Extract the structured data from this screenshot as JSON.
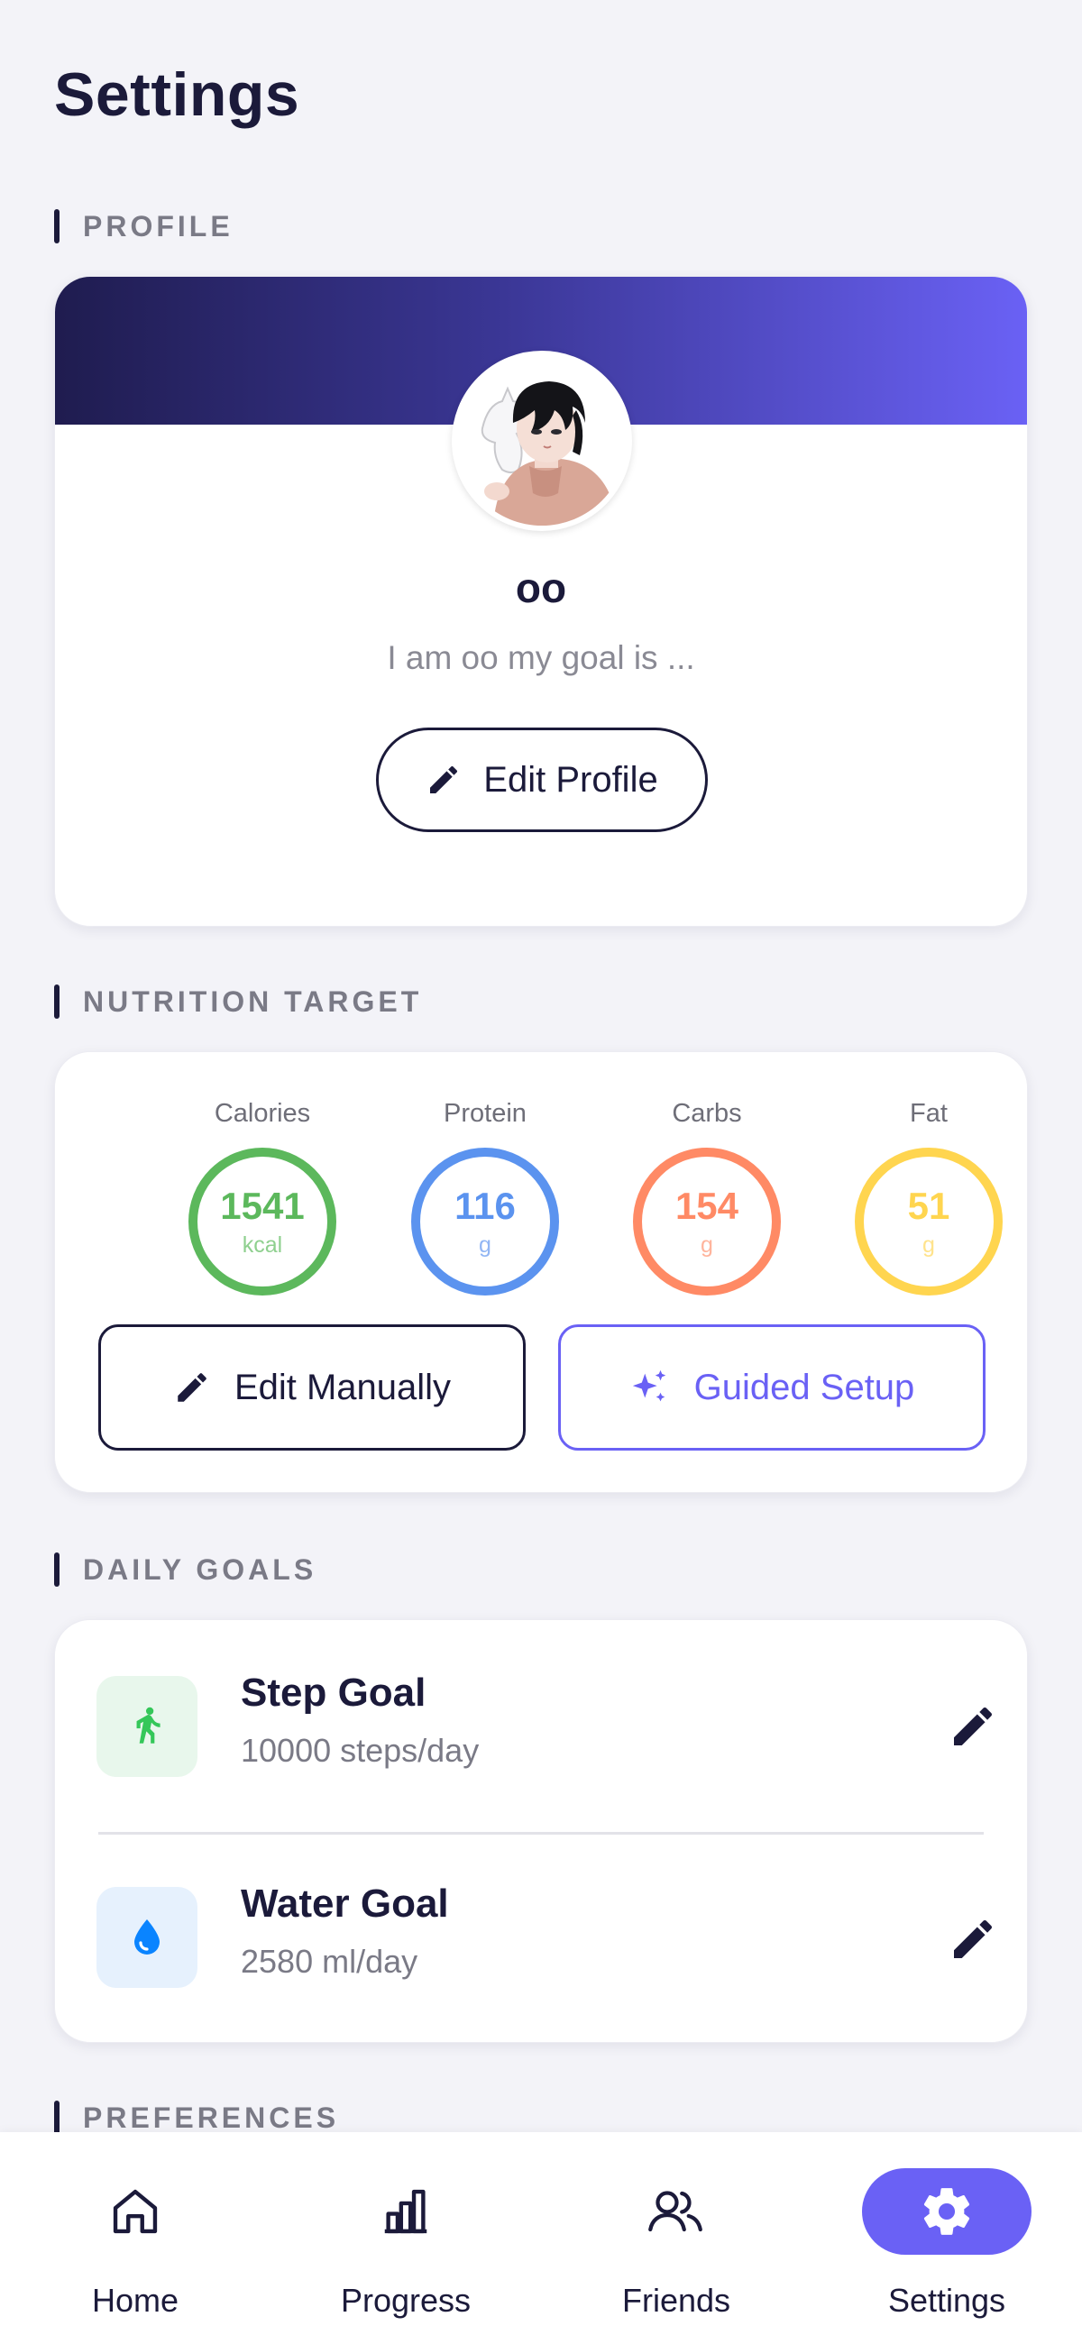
{
  "page": {
    "title": "Settings"
  },
  "sections": {
    "profile": "PROFILE",
    "nutrition": "NUTRITION TARGET",
    "daily_goals": "DAILY GOALS",
    "preferences": "PREFERENCES"
  },
  "profile": {
    "name": "oo",
    "bio": "I am oo my goal is ...",
    "edit_label": "Edit Profile",
    "banner_colors": [
      "#1f1c4f",
      "#6a61f5"
    ]
  },
  "nutrition": {
    "macros": [
      {
        "label": "Calories",
        "value": "1541",
        "unit": "kcal",
        "color": "#5cb85c"
      },
      {
        "label": "Protein",
        "value": "116",
        "unit": "g",
        "color": "#5b93ef"
      },
      {
        "label": "Carbs",
        "value": "154",
        "unit": "g",
        "color": "#ff8a65"
      },
      {
        "label": "Fat",
        "value": "51",
        "unit": "g",
        "color": "#ffd54f"
      }
    ],
    "edit_manually_label": "Edit Manually",
    "guided_setup_label": "Guided Setup"
  },
  "daily_goals": [
    {
      "title": "Step Goal",
      "value": "10000 steps/day",
      "icon": "walk-icon",
      "icon_color": "#34c759",
      "icon_bg": "#e8f7ec"
    },
    {
      "title": "Water Goal",
      "value": "2580 ml/day",
      "icon": "water-drop-icon",
      "icon_color": "#0a84ff",
      "icon_bg": "#e6f1fd"
    }
  ],
  "nav": {
    "items": [
      {
        "label": "Home",
        "icon": "home-icon",
        "active": false
      },
      {
        "label": "Progress",
        "icon": "bar-chart-icon",
        "active": false
      },
      {
        "label": "Friends",
        "icon": "people-icon",
        "active": false
      },
      {
        "label": "Settings",
        "icon": "gear-icon",
        "active": true
      }
    ]
  },
  "colors": {
    "accent": "#6a61f5",
    "dark": "#1b1a3a",
    "background": "#f3f3f8"
  }
}
